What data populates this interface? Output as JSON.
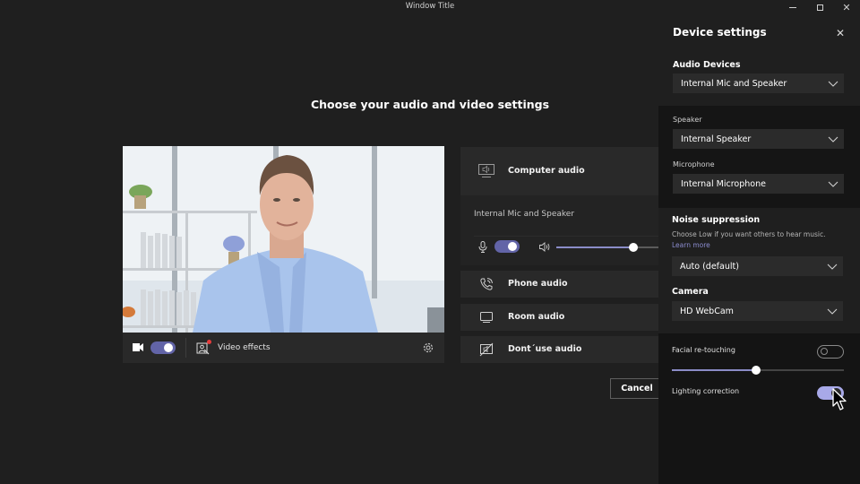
{
  "window": {
    "title": "Window Title",
    "controls": [
      "minimize",
      "maximize",
      "close"
    ]
  },
  "main": {
    "title": "Choose your audio and video settings",
    "video": {
      "camera_on": true,
      "effects_label": "Video effects",
      "effects_notification": true,
      "icons": {
        "camera": "video-camera-icon",
        "effects": "video-effects-icon",
        "settings": "gear-icon"
      }
    },
    "audio_options": [
      {
        "id": "computer",
        "label": "Computer audio",
        "icon": "computer-speaker-icon",
        "selected": true
      },
      {
        "id": "phone",
        "label": "Phone audio",
        "icon": "phone-icon",
        "selected": false
      },
      {
        "id": "room",
        "label": "Room audio",
        "icon": "monitor-icon",
        "selected": false
      },
      {
        "id": "none",
        "label": "Dont´use audio",
        "icon": "no-audio-icon",
        "selected": false
      }
    ],
    "computer_audio": {
      "device": "Internal Mic and Speaker",
      "mic_on": true,
      "volume_percent": 75
    },
    "cancel_label": "Cancel"
  },
  "device_settings": {
    "title": "Device settings",
    "audio_devices": {
      "label": "Audio Devices",
      "value": "Internal Mic and Speaker"
    },
    "speaker": {
      "label": "Speaker",
      "value": "Internal Speaker"
    },
    "microphone": {
      "label": "Microphone",
      "value": "Internal Microphone"
    },
    "noise_suppression": {
      "label": "Noise suppression",
      "help": "Choose Low if you want others to hear music.",
      "learn_more": "Learn more",
      "value": "Auto (default)"
    },
    "camera": {
      "label": "Camera",
      "value": "HD WebCam"
    },
    "facial_retouching": {
      "label": "Facial re-touching",
      "enabled": false,
      "level_percent": 49
    },
    "lighting_correction": {
      "label": "Lighting correction",
      "enabled": true
    }
  },
  "colors": {
    "accent": "#6264a7",
    "accent_light": "#a8a9e8",
    "link": "#8b8ccf",
    "background": "#1f1f1f",
    "panel_dark": "#141414"
  }
}
